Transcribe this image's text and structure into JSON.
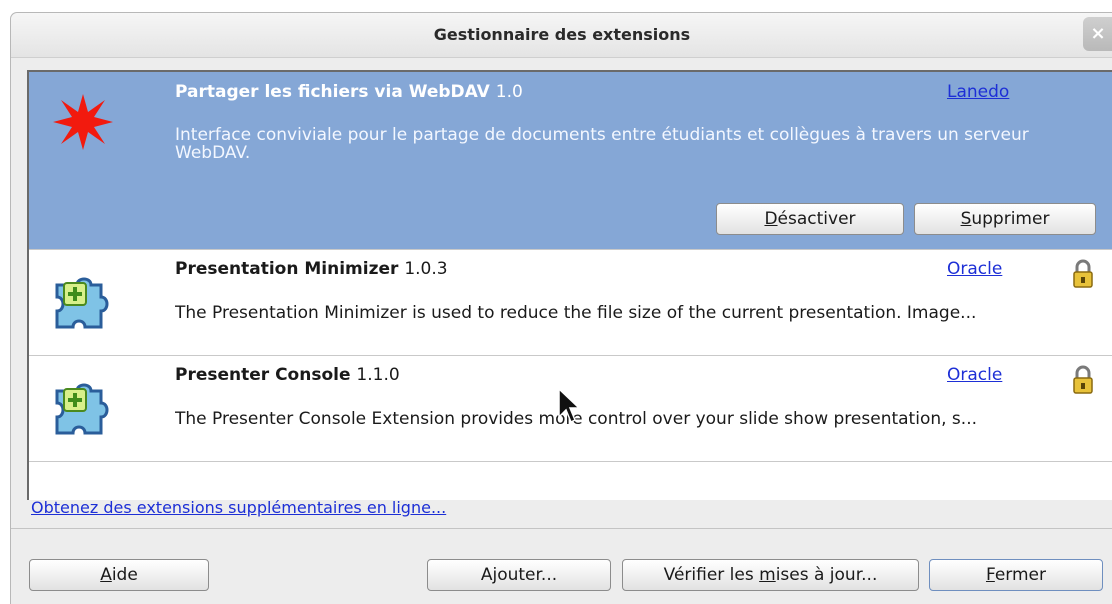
{
  "window": {
    "title": "Gestionnaire des extensions",
    "close_label": "×"
  },
  "extensions": [
    {
      "name": "Partager les fichiers via WebDAV",
      "version": "1.0",
      "publisher": "Lanedo",
      "description": "Interface conviviale pour le partage de documents entre étudiants et collègues à travers un serveur WebDAV.",
      "icon": "red-star-icon",
      "selected": true,
      "buttons": {
        "disable": {
          "pre": "",
          "mn": "D",
          "post": "ésactiver"
        },
        "remove": {
          "pre": "",
          "mn": "S",
          "post": "upprimer"
        }
      }
    },
    {
      "name": "Presentation Minimizer",
      "version": "1.0.3",
      "publisher": "Oracle",
      "description": "The Presentation Minimizer is used to reduce the file size of the current presentation. Image...",
      "icon": "puzzle-extension-icon",
      "locked": true
    },
    {
      "name": "Presenter Console",
      "version": "1.1.0",
      "publisher": "Oracle",
      "description": "The Presenter Console Extension provides more control over your slide show presentation, s...",
      "icon": "puzzle-extension-icon",
      "locked": true
    }
  ],
  "get_more_link": "Obtenez des extensions supplémentaires en ligne...",
  "footer": {
    "help": {
      "pre": "",
      "mn": "A",
      "post": "ide"
    },
    "add": {
      "pre": "A",
      "mn": "j",
      "post": "outer..."
    },
    "check_updates": {
      "pre": "Vérifier les ",
      "mn": "m",
      "post": "ises à jour..."
    },
    "close": {
      "pre": "",
      "mn": "F",
      "post": "ermer"
    }
  },
  "colors": {
    "selection": "#85a7d6",
    "link": "#1d2fd6",
    "dialog_bg": "#ededed"
  }
}
